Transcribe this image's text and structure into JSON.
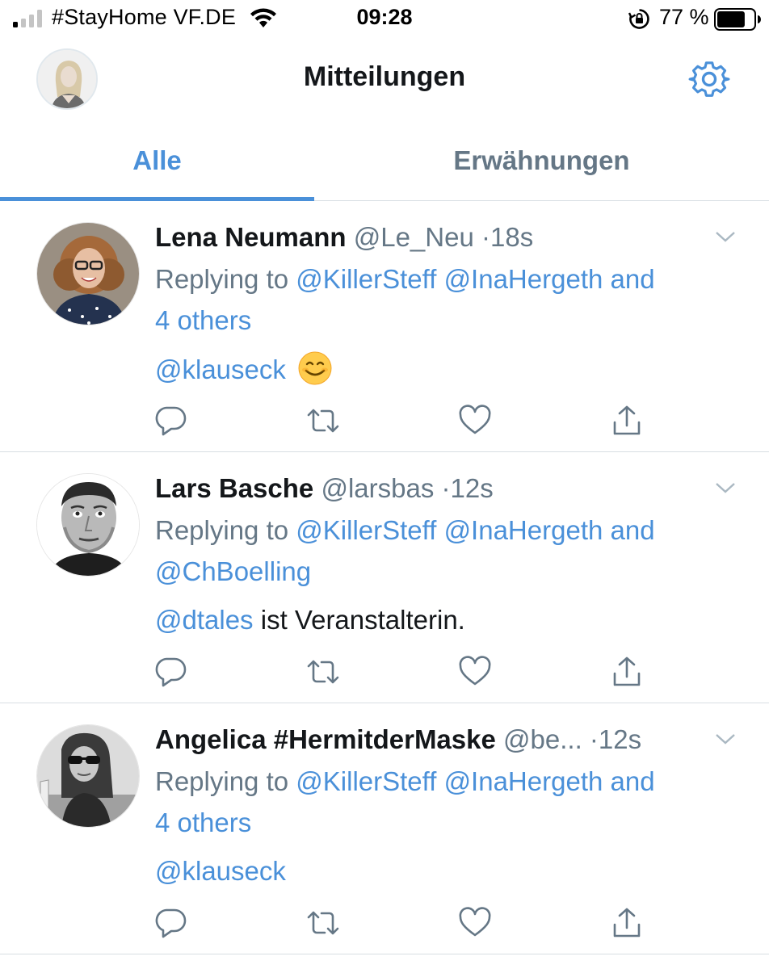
{
  "status_bar": {
    "carrier": "#StayHome VF.DE",
    "time": "09:28",
    "battery_percent": "77 %",
    "signal_bars_filled": 1,
    "signal_bars_total": 4,
    "battery_level": 0.77,
    "icons": [
      "signal-bars-icon",
      "wifi-icon",
      "rotation-lock-icon",
      "battery-icon"
    ]
  },
  "header": {
    "title": "Mitteilungen",
    "settings_icon": "gear-icon"
  },
  "tabs": [
    {
      "label": "Alle",
      "active": true
    },
    {
      "label": "Erwähnungen",
      "active": false
    }
  ],
  "tweets": [
    {
      "name": "Lena Neumann",
      "handle": "@Le_Neu",
      "dot": "·",
      "time": "18s",
      "replying_prefix": "Replying to ",
      "replying_to_1": "@KillerSteff",
      "replying_to_2": "@InaHergeth",
      "replying_and": "and",
      "replying_line2": "4 others",
      "text_link": "@klauseck",
      "text_rest": "",
      "emoji": "smiling-face-emoji"
    },
    {
      "name": "Lars Basche",
      "handle": "@larsbas",
      "dot": "·",
      "time": "12s",
      "replying_prefix": "Replying to ",
      "replying_to_1": "@KillerSteff",
      "replying_to_2": "@InaHergeth",
      "replying_and": "and",
      "replying_line2": "@ChBoelling",
      "text_link": "@dtales",
      "text_rest": " ist Veranstalterin."
    },
    {
      "name": "Angelica #HermitderMaske",
      "handle": "@be...",
      "dot": "·",
      "time": "12s",
      "replying_prefix": "Replying to ",
      "replying_to_1": "@KillerSteff",
      "replying_to_2": "@InaHergeth",
      "replying_and": "and",
      "replying_line2": "4 others",
      "text_link": "@klauseck",
      "text_rest": ""
    }
  ],
  "action_icons": [
    "reply-icon",
    "retweet-icon",
    "like-icon",
    "share-icon"
  ],
  "colors": {
    "accent": "#4a90d9",
    "secondary_text": "#657786",
    "divider": "#d8dee3"
  }
}
